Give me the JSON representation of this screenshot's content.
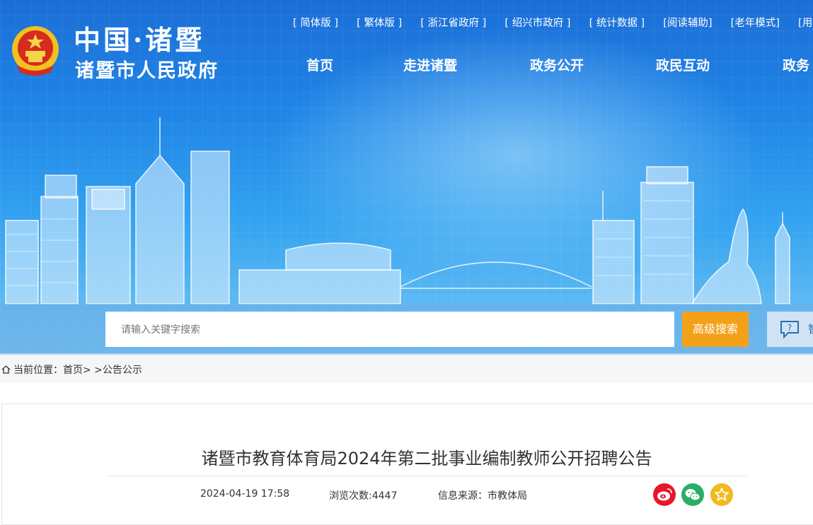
{
  "header": {
    "site_name_cn": "中国·诸暨",
    "site_name": "诸暨市人民政府",
    "top_links": [
      "[ 简体版 ]",
      "[ 繁体版 ]",
      "[ 浙江省政府 ]",
      "[ 绍兴市政府 ]",
      "[ 统计数据 ]",
      "[阅读辅助]",
      "[老年模式]",
      "[用"
    ],
    "nav": [
      "首页",
      "走进诸暨",
      "政务公开",
      "政民互动",
      "政务"
    ]
  },
  "search": {
    "placeholder": "请输入关键字搜索",
    "advanced_label": "高级搜索",
    "help_label": "智"
  },
  "breadcrumb": {
    "prefix": "当前位置：",
    "home": "首页",
    "sep": "> >",
    "current": "公告公示"
  },
  "article": {
    "title": "诸暨市教育体育局2024年第二批事业编制教师公开招聘公告",
    "date": "2024-04-19 17:58",
    "views": "浏览次数:4447",
    "source": "信息来源：市教体局"
  },
  "colors": {
    "banner_blue": "#1f84e6",
    "accent_orange": "#f4a11a",
    "weibo_red": "#e6162d",
    "wechat_green": "#2aae67",
    "favorite_yellow": "#f0b91c"
  },
  "share_icons": [
    "weibo-icon",
    "wechat-icon",
    "favorite-star-icon"
  ]
}
